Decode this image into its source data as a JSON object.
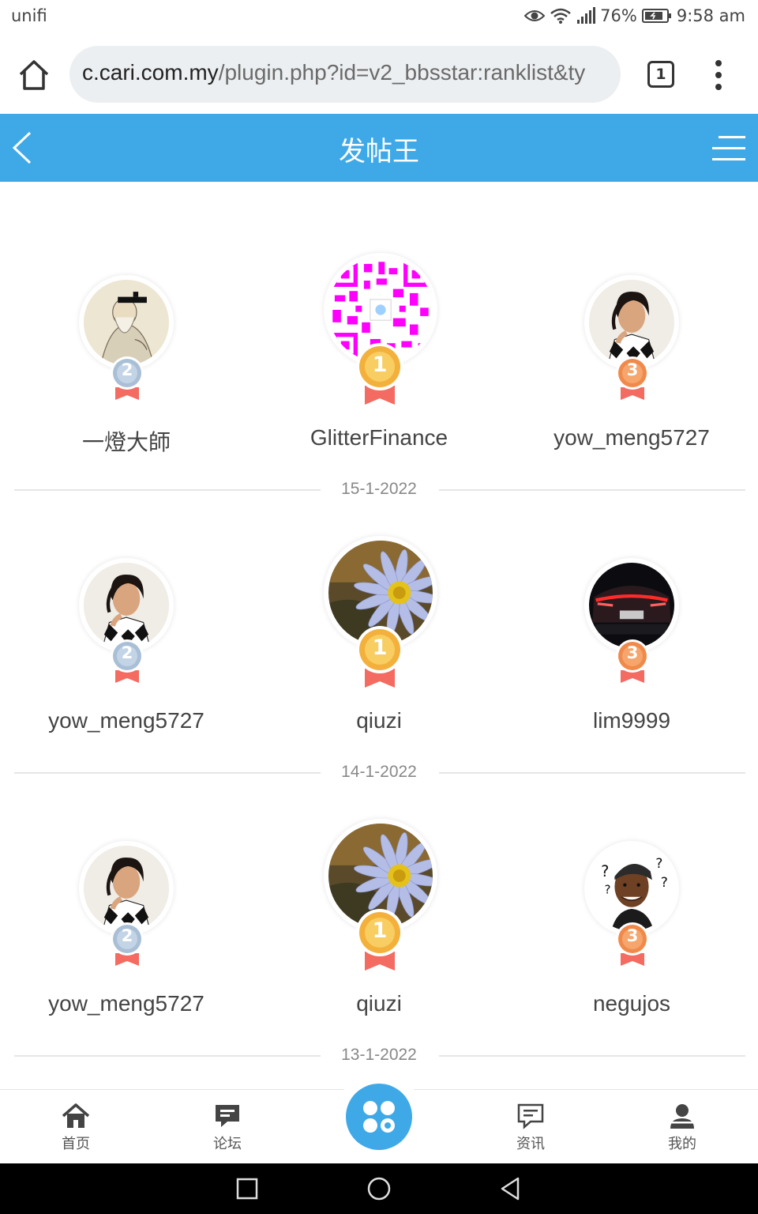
{
  "status_bar": {
    "carrier": "unifi",
    "battery": "76%",
    "time": "9:58 am"
  },
  "browser": {
    "url_host": "c.cari.com.my",
    "url_path": "/plugin.php?id=v2_bbsstar:ranklist&ty",
    "tab_count": "1"
  },
  "header": {
    "title": "发帖王"
  },
  "rankings": [
    {
      "date": "15-1-2022",
      "users": [
        {
          "rank": "2",
          "name": "一燈大師",
          "avatar": "sage-avatar"
        },
        {
          "rank": "1",
          "name": "GlitterFinance",
          "avatar": "qr-code-avatar"
        },
        {
          "rank": "3",
          "name": "yow_meng5727",
          "avatar": "man-portrait-avatar"
        }
      ]
    },
    {
      "date": "14-1-2022",
      "users": [
        {
          "rank": "2",
          "name": "yow_meng5727",
          "avatar": "man-portrait-avatar"
        },
        {
          "rank": "1",
          "name": "qiuzi",
          "avatar": "daisy-flower-avatar"
        },
        {
          "rank": "3",
          "name": "lim9999",
          "avatar": "car-taillight-avatar"
        }
      ]
    },
    {
      "date": "13-1-2022",
      "users": [
        {
          "rank": "2",
          "name": "yow_meng5727",
          "avatar": "man-portrait-avatar"
        },
        {
          "rank": "1",
          "name": "qiuzi",
          "avatar": "daisy-flower-avatar"
        },
        {
          "rank": "3",
          "name": "negujos",
          "avatar": "confused-man-avatar"
        }
      ]
    }
  ],
  "bottom_nav": [
    {
      "label": "首页",
      "icon": "home-icon"
    },
    {
      "label": "论坛",
      "icon": "forum-icon"
    },
    {
      "label": "",
      "icon": "apps-icon"
    },
    {
      "label": "资讯",
      "icon": "news-icon"
    },
    {
      "label": "我的",
      "icon": "profile-icon"
    }
  ],
  "colors": {
    "brand": "#3fa9e8",
    "gold": "#f3b13c",
    "silver": "#a9bfd6",
    "bronze": "#f08a4b",
    "ribbon": "#f36b61"
  }
}
